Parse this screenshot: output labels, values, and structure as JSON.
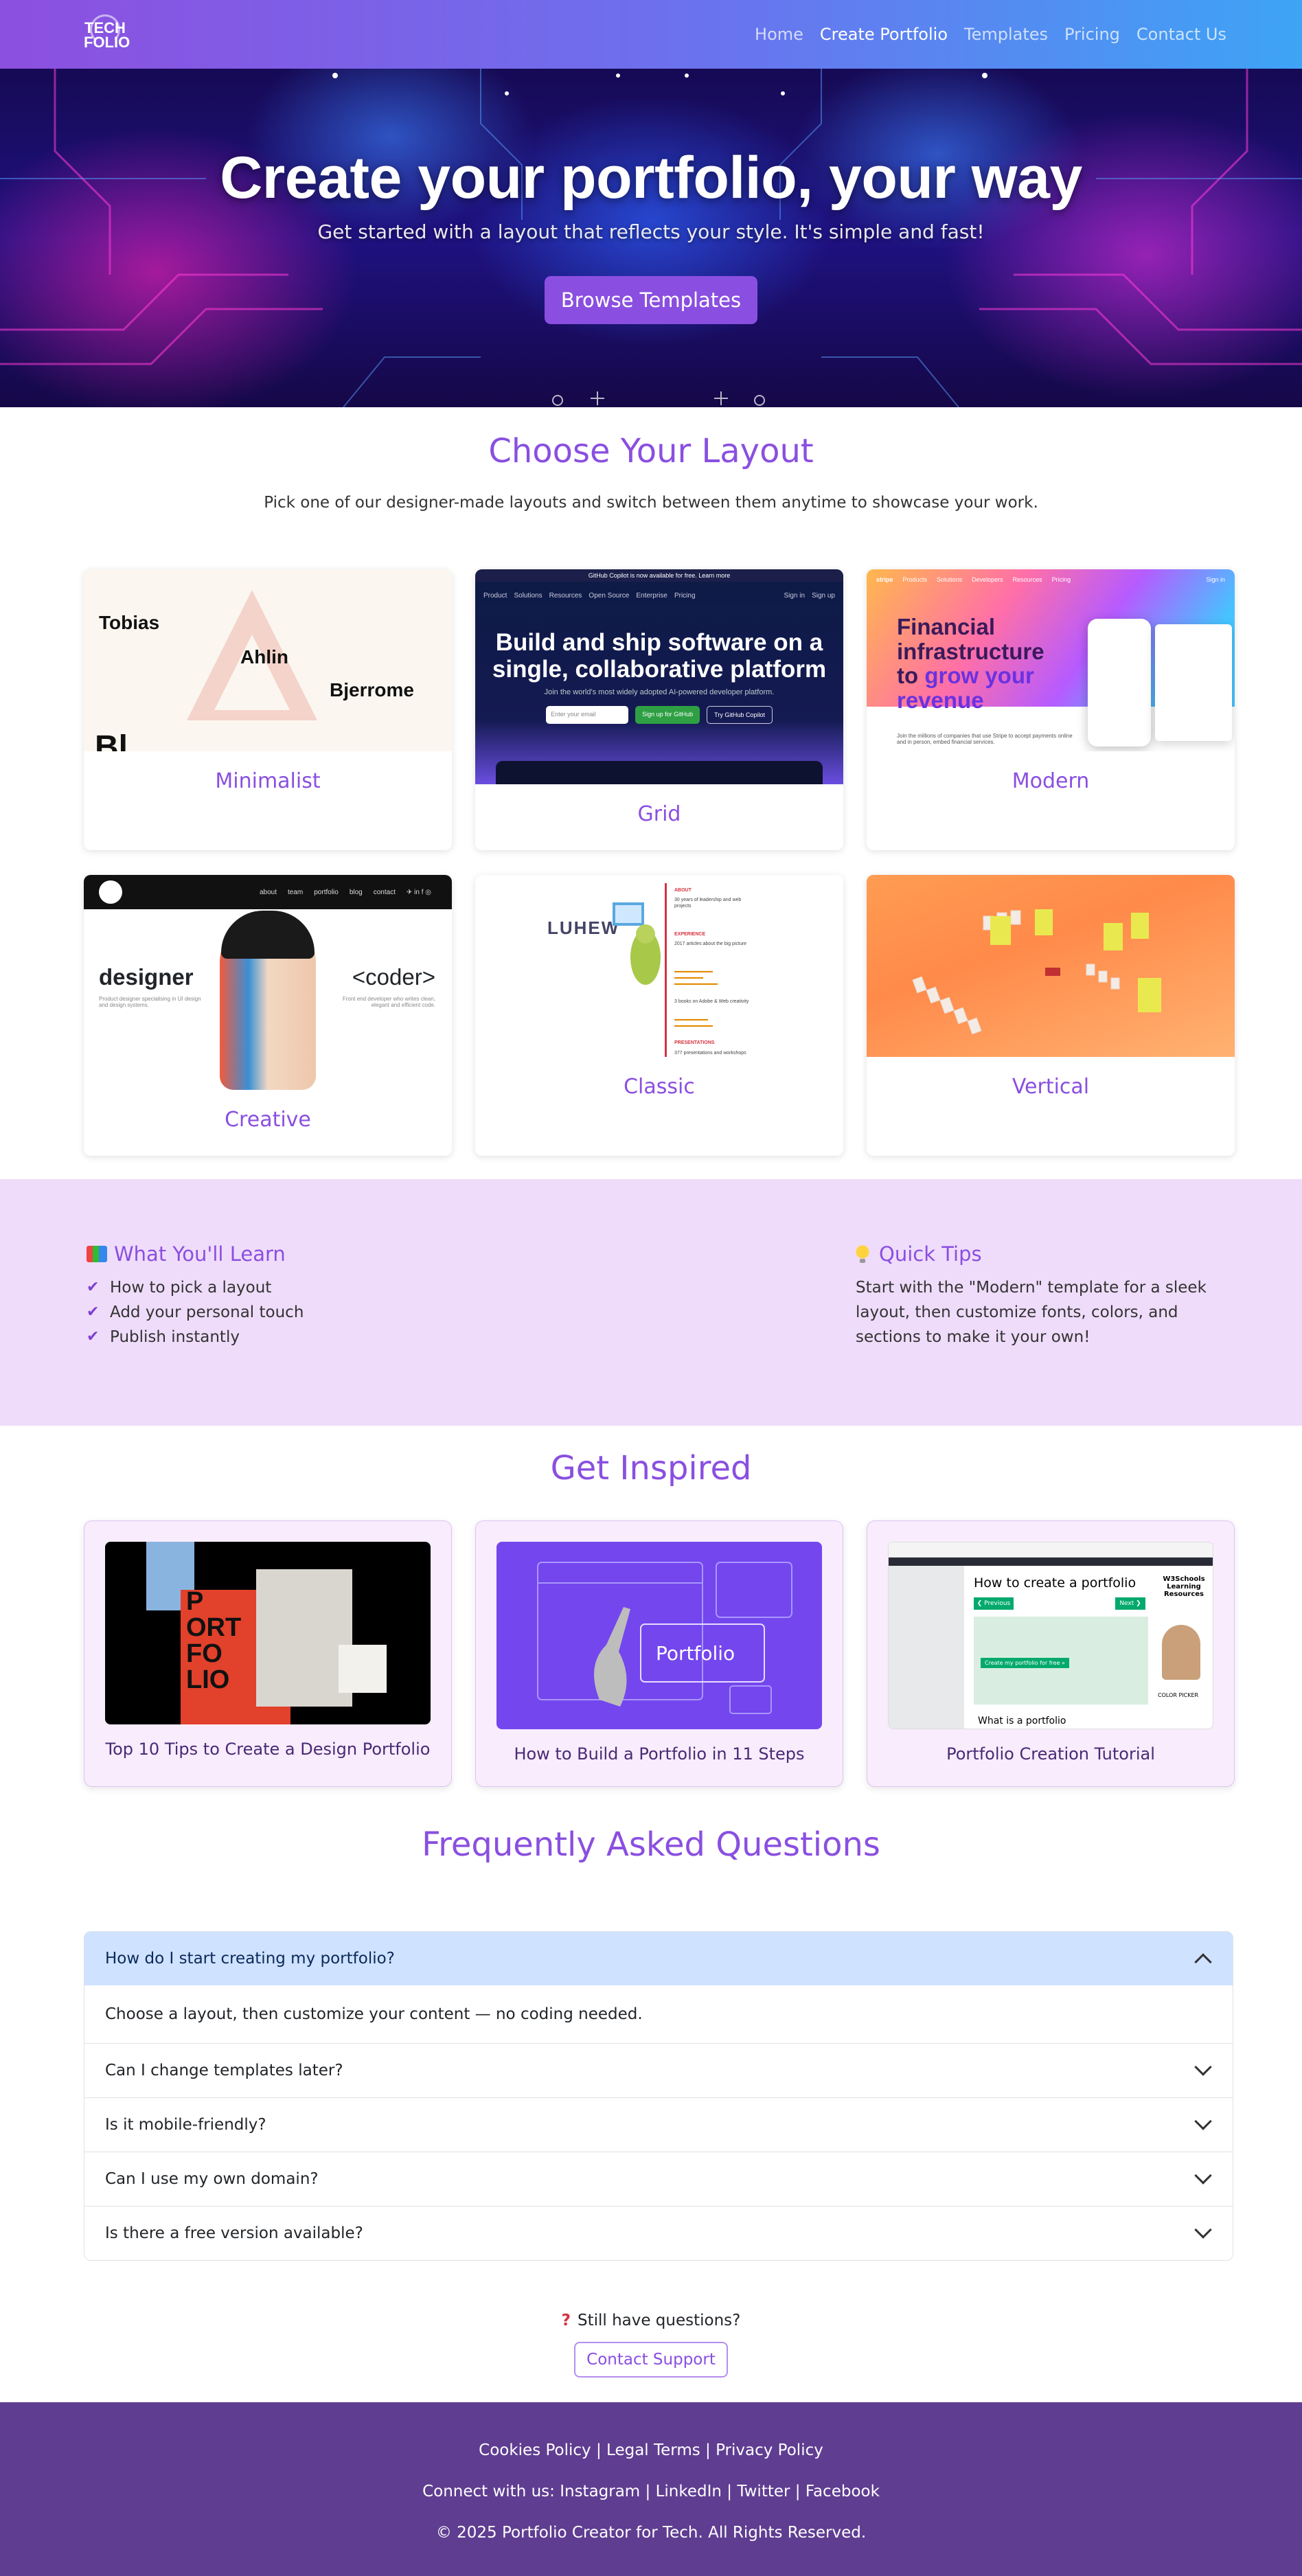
{
  "nav": {
    "logo_top": "TECH",
    "logo_bottom": "FOLIO",
    "links": [
      "Home",
      "Create Portfolio",
      "Templates",
      "Pricing",
      "Contact Us"
    ],
    "active_index": 1
  },
  "hero": {
    "title": "Create your portfolio, your way",
    "subtitle": "Get started with a layout that reflects your style. It's simple and fast!",
    "cta": "Browse Templates"
  },
  "layouts": {
    "title": "Choose Your Layout",
    "subtitle": "Pick one of our designer-made layouts and switch between them anytime to showcase your work.",
    "cards": [
      {
        "label": "Minimalist"
      },
      {
        "label": "Grid"
      },
      {
        "label": "Modern"
      },
      {
        "label": "Creative"
      },
      {
        "label": "Classic"
      },
      {
        "label": "Vertical"
      }
    ],
    "thumb_text": {
      "minimal": [
        "Tobias",
        "Ahlin",
        "Bjerrome",
        "Bl"
      ],
      "grid_banner": "GitHub Copilot is now available for free. Learn more",
      "grid_nav": [
        "Product",
        "Solutions",
        "Resources",
        "Open Source",
        "Enterprise",
        "Pricing",
        "Sign in",
        "Sign up"
      ],
      "grid_headline": "Build and ship software on a single, collaborative platform",
      "grid_caption": "Join the world's most widely adopted AI-powered developer platform.",
      "grid_input": "Enter your email",
      "grid_btn1": "Sign up for GitHub",
      "grid_btn2": "Try GitHub Copilot",
      "modern_nav": [
        "stripe",
        "Products",
        "Solutions",
        "Developers",
        "Resources",
        "Pricing",
        "Sign in"
      ],
      "modern_line1": "Financial",
      "modern_line2": "infrastructure",
      "modern_line3a": "to ",
      "modern_line3b": "grow your",
      "modern_line4": "revenue",
      "modern_foot": "Join the millions of companies that use Stripe to accept payments online and in person, embed financial services.",
      "creative_nav": [
        "about",
        "team",
        "portfolio",
        "blog",
        "contact"
      ],
      "creative_left": "designer",
      "creative_right": "<coder>",
      "creative_left_sub": "Product designer specialising in UI design and design systems.",
      "creative_right_sub": "Front end developer who writes clean, elegant and efficient code.",
      "classic_logo": "LUHEW",
      "classic_entries": [
        "ABOUT",
        "30 years of leadership and web projects",
        "EXPERIENCE",
        "2017 articles about the big picture",
        "3 books on Adobe & Web creativity",
        "PRESENTATIONS",
        "377 presentations and workshops"
      ]
    }
  },
  "learn": {
    "title": "What You'll Learn",
    "items": [
      "How to pick a layout",
      "Add your personal touch",
      "Publish instantly"
    ],
    "tips_title": "Quick Tips",
    "tips_text": "Start with the \"Modern\" template for a sleek layout, then customize fonts, colors, and sections to make it your own!"
  },
  "inspire": {
    "title": "Get Inspired",
    "cards": [
      {
        "caption": "Top 10 Tips to Create a Design Portfolio"
      },
      {
        "caption": "How to Build a Portfolio in 11 Steps"
      },
      {
        "caption": "Portfolio Creation Tutorial"
      }
    ],
    "thumb_text": {
      "p1": [
        "P",
        "ORT",
        "FO",
        "LIO"
      ],
      "p2": "Portfolio",
      "p3_title": "How to create a portfolio",
      "p3_prev": "❮ Previous",
      "p3_next": "Next ❯",
      "p3_btn": "Create my portfolio for free »",
      "p3_h2": "What is a portfolio",
      "p3_side": "W3Schools Learning Resources",
      "p3_picker": "COLOR PICKER"
    }
  },
  "faq": {
    "title": "Frequently Asked Questions",
    "items": [
      {
        "q": "How do I start creating my portfolio?",
        "a": "Choose a layout, then customize your content — no coding needed.",
        "open": true
      },
      {
        "q": "Can I change templates later?",
        "open": false
      },
      {
        "q": "Is it mobile-friendly?",
        "open": false
      },
      {
        "q": "Can I use my own domain?",
        "open": false
      },
      {
        "q": "Is there a free version available?",
        "open": false
      }
    ]
  },
  "support": {
    "text": "Still have questions?",
    "button": "Contact Support"
  },
  "footer": {
    "links": [
      "Cookies Policy",
      "Legal Terms",
      "Privacy Policy"
    ],
    "social_prefix": "Connect with us:",
    "social": [
      "Instagram",
      "LinkedIn",
      "Twitter",
      "Facebook"
    ],
    "copyright": "© 2025 Portfolio Creator for Tech. All Rights Reserved."
  },
  "colors": {
    "accent": "#8a4fe0",
    "nav_gradient_start": "#8d4fe0",
    "nav_gradient_end": "#3ea4f5",
    "learn_bg": "#efdcfa",
    "faq_open_bg": "#cfe2ff",
    "footer_bg": "#5f3d91"
  }
}
